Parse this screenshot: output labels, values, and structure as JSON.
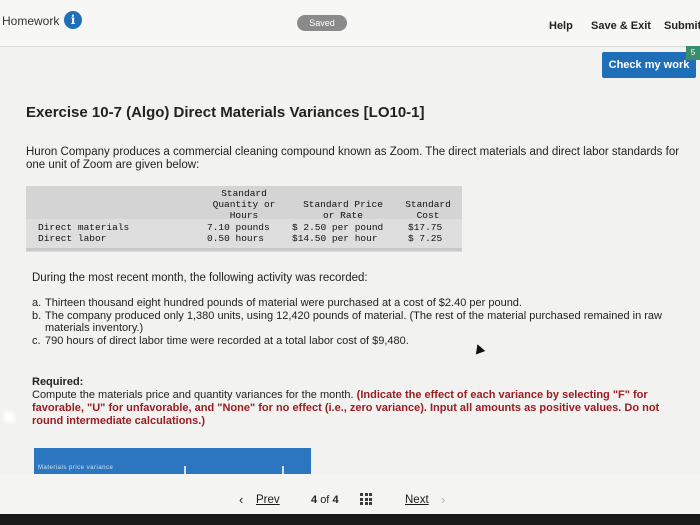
{
  "header": {
    "homework_label": "Homework",
    "info_glyph": "i",
    "saved_label": "Saved",
    "help_label": "Help",
    "save_exit_label": "Save & Exit",
    "submit_label": "Submit",
    "check_button_label": "Check my work",
    "check_corner": "5"
  },
  "exercise": {
    "title": "Exercise 10-7 (Algo) Direct Materials Variances [LO10-1]",
    "description": "Huron Company produces a commercial cleaning compound known as Zoom. The direct materials and direct labor standards for one unit of Zoom are given below:"
  },
  "standards_table": {
    "col1_header": [
      "Standard",
      "Quantity or",
      "Hours"
    ],
    "col2_header": [
      "Standard Price",
      "or Rate"
    ],
    "col3_header": [
      "Standard",
      "Cost"
    ],
    "rows": [
      {
        "label": "Direct materials",
        "qty": "7.10 pounds",
        "price": "$ 2.50 per pound",
        "cost": "$17.75"
      },
      {
        "label": "Direct labor",
        "qty": "0.50 hours",
        "price": "$14.50 per hour",
        "cost": "$ 7.25"
      }
    ]
  },
  "activity": {
    "intro": "During the most recent month, the following activity was recorded:",
    "items": [
      {
        "marker": "a.",
        "text": "Thirteen thousand eight hundred pounds of material were purchased at a cost of $2.40 per pound."
      },
      {
        "marker": "b.",
        "text": "The company produced only 1,380 units, using 12,420 pounds of material. (The rest of the material purchased remained in raw materials inventory.)"
      },
      {
        "marker": "c.",
        "text": "790 hours of direct labor time were recorded at a total labor cost of $9,480."
      }
    ]
  },
  "required": {
    "title": "Required:",
    "text_plain": "Compute the materials price and quantity variances for the month. ",
    "text_red": "(Indicate the effect of each variance by selecting \"F\" for favorable, \"U\" for unfavorable, and \"None\" for no effect (i.e., zero variance). Input all amounts as positive values. Do not round intermediate calculations.)"
  },
  "answer_bar": {
    "caption": "Materials price variance"
  },
  "navigation": {
    "prev_label": "Prev",
    "current_page": "4",
    "of_label": "of",
    "total_pages": "4",
    "next_label": "Next"
  }
}
